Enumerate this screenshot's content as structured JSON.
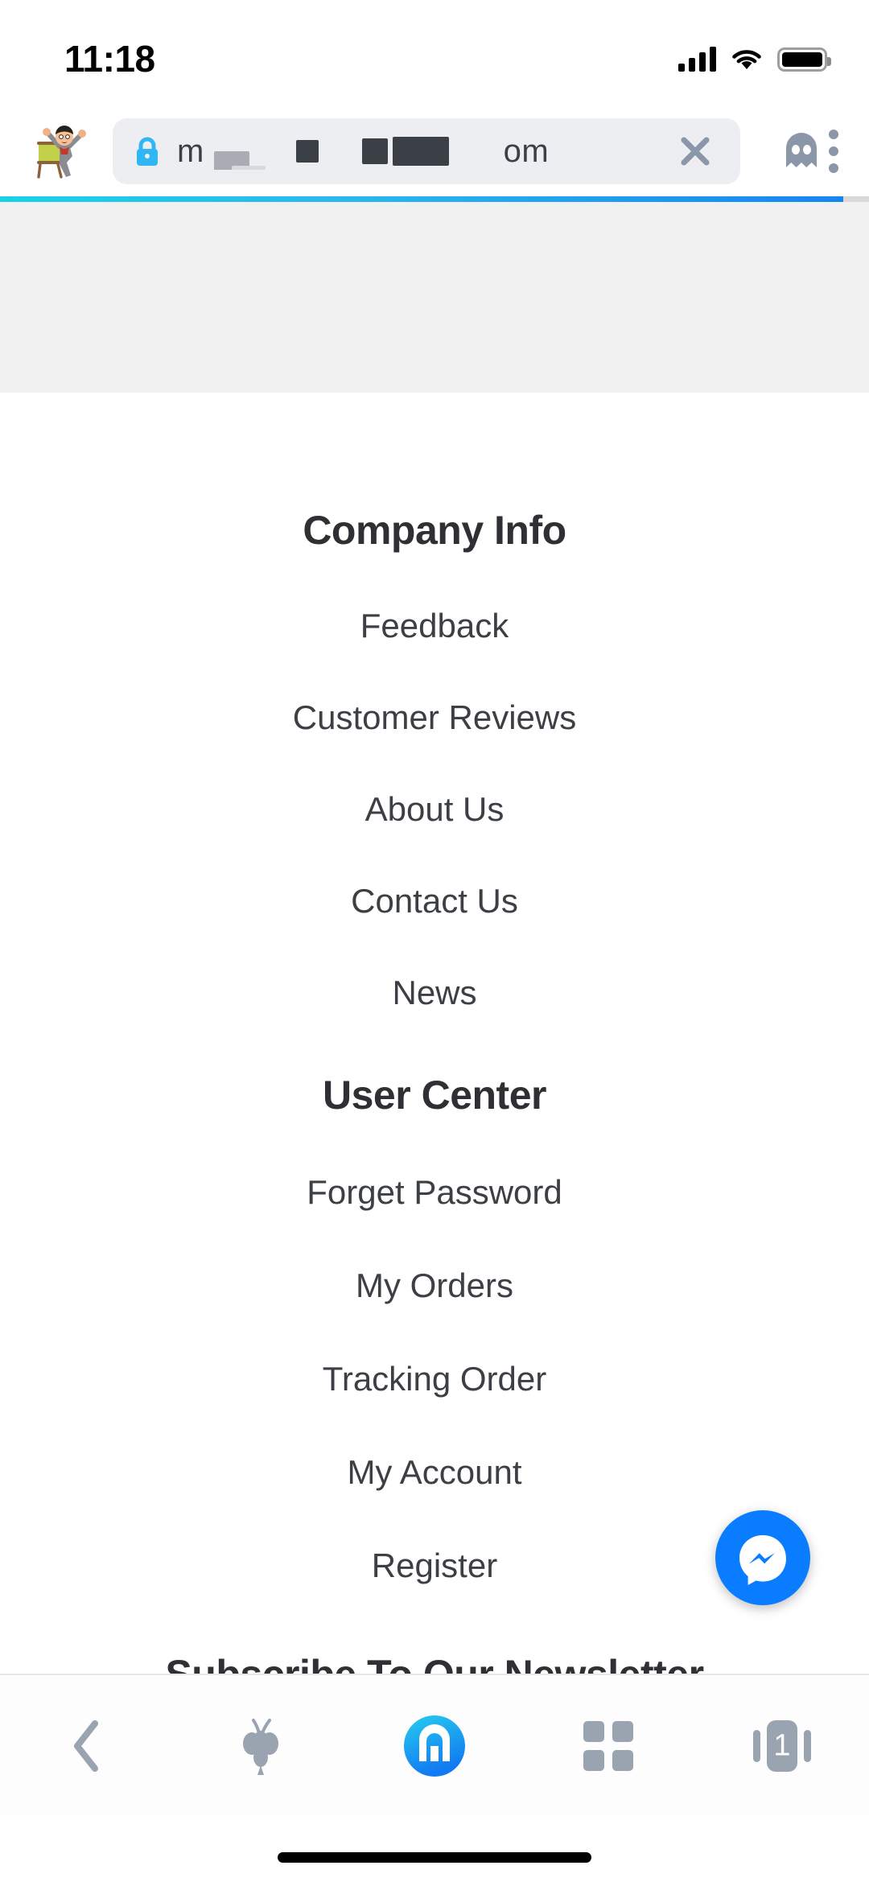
{
  "status_bar": {
    "time": "11:18",
    "signal_icon": "cellular-signal-icon",
    "wifi_icon": "wifi-icon",
    "battery_icon": "battery-full-icon"
  },
  "browser": {
    "name": "Maxthon",
    "favicon_name": "site-favicon-cartoon-man",
    "url_prefix": "m",
    "url_suffix": "om",
    "url_redacted": true,
    "lock_icon": "secure-lock-icon",
    "lock_color": "#2eb6f5",
    "close_label": "✕",
    "private_mode_icon": "ghost-incognito-icon",
    "menu_icon": "kebab-menu-icon",
    "progress_percent": 97,
    "progress_color_start": "#1ad1e8",
    "progress_color_end": "#1586f0"
  },
  "page_content": {
    "company_section": {
      "heading": "Company Info",
      "links": [
        "Feedback",
        "Customer Reviews",
        "About Us",
        "Contact Us",
        "News"
      ]
    },
    "user_section": {
      "heading": "User Center",
      "links": [
        "Forget Password",
        "My Orders",
        "Tracking Order",
        "My Account",
        "Register"
      ]
    },
    "newsletter_heading": "Subscribe To Our Newsletter"
  },
  "messenger_fab": {
    "name": "facebook-messenger-chat-button",
    "color": "#0a7cff"
  },
  "bottom_toolbar": {
    "items": [
      {
        "name": "back-button",
        "icon": "chevron-left-icon"
      },
      {
        "name": "maxthon-cloud-button",
        "icon": "cloud-bee-icon"
      },
      {
        "name": "home-button",
        "icon": "maxthon-logo-icon"
      },
      {
        "name": "apps-grid-button",
        "icon": "grid-squares-icon"
      },
      {
        "name": "tabs-button",
        "icon": "tab-switcher-icon",
        "count": "1"
      }
    ]
  },
  "home_indicator": {
    "name": "home-indicator"
  }
}
